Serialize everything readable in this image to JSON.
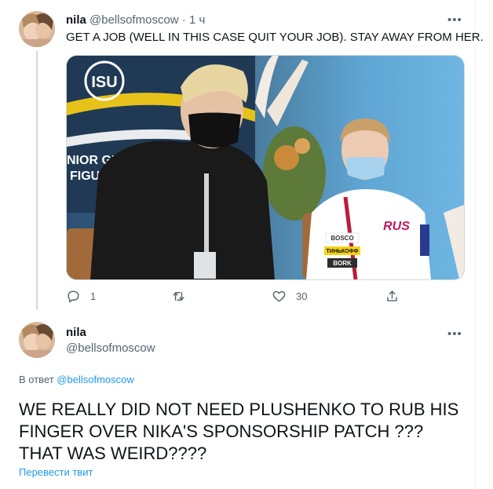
{
  "tweet": {
    "author_name": "nila",
    "handle": "@bellsofmoscow",
    "separator": "·",
    "time": "1 ч",
    "text": "GET A JOB (WELL IN THIS CASE QUIT YOUR JOB). STAY AWAY FROM HER.",
    "more_icon": "more-horizontal-icon",
    "media": {
      "isu_logo": "ISU",
      "banner_line1": "NIOR GRAN",
      "banner_line2": "FIGURE",
      "sponsor_1": "BOSCO",
      "sponsor_2": "ТИНЬКОФФ",
      "sponsor_3": "BORK",
      "team_logo": "RUS"
    },
    "actions": {
      "reply_count": "1",
      "retweet_count": "",
      "like_count": "30",
      "icons": [
        "reply-icon",
        "retweet-icon",
        "like-icon",
        "share-icon"
      ]
    }
  },
  "reply_tweet": {
    "author_name": "nila",
    "handle": "@bellsofmoscow",
    "reply_prefix": "В ответ",
    "reply_to": "@bellsofmoscow",
    "text": "WE REALLY DID NOT NEED PLUSHENKO TO RUB HIS FINGER OVER NIKA'S SPONSORSHIP PATCH ??? THAT WAS WEIRD????",
    "translate_label": "Перевести твит"
  },
  "colors": {
    "link": "#1d9bf0",
    "muted": "#536471",
    "text": "#0f1419",
    "thread_line": "#cfd9de"
  }
}
